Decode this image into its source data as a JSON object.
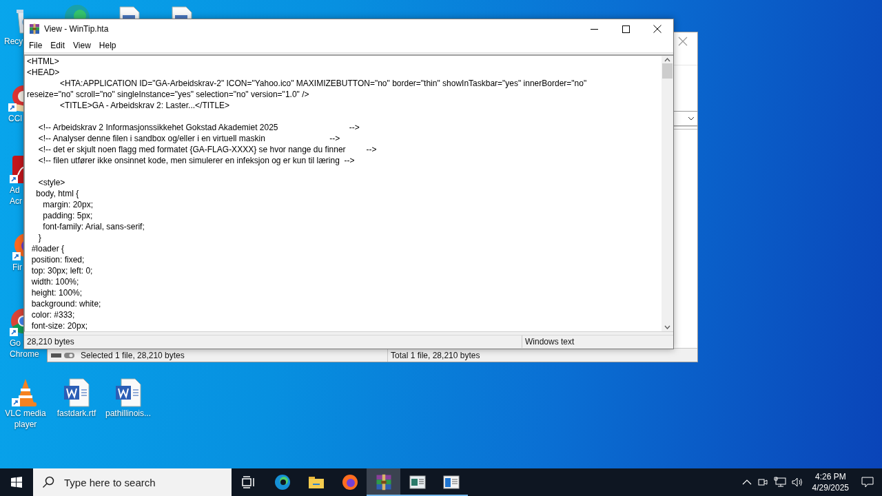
{
  "desktop": {
    "icons": [
      {
        "kind": "recycle-bin",
        "shortcut": false,
        "label_lines": [
          "Recy"
        ]
      },
      {
        "kind": "edge"
      },
      {
        "kind": "document"
      },
      {
        "kind": "document"
      },
      {
        "kind": "ccleaner",
        "shortcut": true,
        "label_lines": [
          "CCl"
        ]
      },
      {
        "kind": "acrobat",
        "shortcut": true,
        "label_lines": [
          "Ad",
          "Acr"
        ]
      },
      {
        "kind": "firefox",
        "shortcut": true,
        "label_lines": [
          "Fir"
        ]
      },
      {
        "kind": "chrome",
        "shortcut": true,
        "label_lines": [
          "Go",
          "Chrome"
        ]
      },
      {
        "kind": "vlc",
        "shortcut": true,
        "label_lines": [
          "VLC media",
          "player"
        ]
      },
      {
        "kind": "word",
        "shortcut": false,
        "label_lines": [
          "fastdark.rtf"
        ]
      },
      {
        "kind": "word",
        "shortcut": false,
        "label_lines": [
          "pathillinois..."
        ]
      }
    ]
  },
  "background_window": {
    "status_bar": [
      "Selected 1 file, 28,210 bytes",
      "Total 1 file, 28,210 bytes"
    ]
  },
  "viewer": {
    "title": "View - WinTip.hta",
    "menu": [
      "File",
      "Edit",
      "View",
      "Help"
    ],
    "lines": [
      {
        "text": "<HTML>",
        "space_before": false
      },
      {
        "text": "<HEAD>",
        "space_before": false
      },
      {
        "text": "\t<HTA:APPLICATION ID=\"GA-Arbeidskrav-2\" ICON=\"Yahoo.ico\" MAXIMIZEBUTTON=\"no\" border=\"thin\" showInTaskbar=\"yes\" innerBorder=\"no\"",
        "space_before": false
      },
      {
        "text": "reseize=\"no\" scroll=\"no\" singleInstance=\"yes\" selection=\"no\" version=\"1.0\" />",
        "space_before": false
      },
      {
        "text": "\t<TITLE>GA - Arbeidskrav 2: Laster...</TITLE>",
        "space_before": false
      },
      {
        "text": "     <!-- Arbeidskrav 2 Informasjonssikkehet Gokstad Akademiet 2025                               -->",
        "space_before": true
      },
      {
        "text": "     <!-- Analyser denne filen i sandbox og/eller i en virtuell maskin                            -->",
        "space_before": false
      },
      {
        "text": "     <!-- det er skjult noen flagg med formatet {GA-FLAG-XXXX} se hvor nange du finner         -->",
        "space_before": false
      },
      {
        "text": "     <!-- filen utfører ikke onsinnet kode, men simulerer en infeksjon og er kun til læring  -->",
        "space_before": false
      },
      {
        "text": "     <style>",
        "space_before": true
      },
      {
        "text": "    body, html {",
        "space_before": false
      },
      {
        "text": "       margin: 20px;",
        "space_before": false
      },
      {
        "text": "       padding: 5px;",
        "space_before": false
      },
      {
        "text": "       font-family: Arial, sans-serif;",
        "space_before": false
      },
      {
        "text": "     }",
        "space_before": false
      },
      {
        "text": "  #loader {",
        "space_before": false
      },
      {
        "text": "  position: fixed;",
        "space_before": false
      },
      {
        "text": "  top: 30px; left: 0;",
        "space_before": false
      },
      {
        "text": "  width: 100%;",
        "space_before": false
      },
      {
        "text": "  height: 100%;",
        "space_before": false
      },
      {
        "text": "  background: white;",
        "space_before": false
      },
      {
        "text": "  color: #333;",
        "space_before": false
      },
      {
        "text": "  font-size: 20px;",
        "space_before": false
      }
    ],
    "status_bar": [
      "28,210 bytes",
      "Windows text"
    ]
  },
  "taskbar": {
    "search": {
      "placeholder": "Type here to search"
    },
    "apps": [
      {
        "kind": "task-view",
        "active": false,
        "running": false
      },
      {
        "kind": "edge",
        "active": false,
        "running": false
      },
      {
        "kind": "explorer",
        "active": false,
        "running": false
      },
      {
        "kind": "firefox",
        "active": false,
        "running": false
      },
      {
        "kind": "archiver",
        "active": true,
        "running": true
      },
      {
        "kind": "document-window",
        "active": false,
        "running": true
      },
      {
        "kind": "app-window",
        "active": false,
        "running": true
      }
    ],
    "clock": {
      "time": "4:26 PM",
      "date": "4/29/2025"
    }
  }
}
